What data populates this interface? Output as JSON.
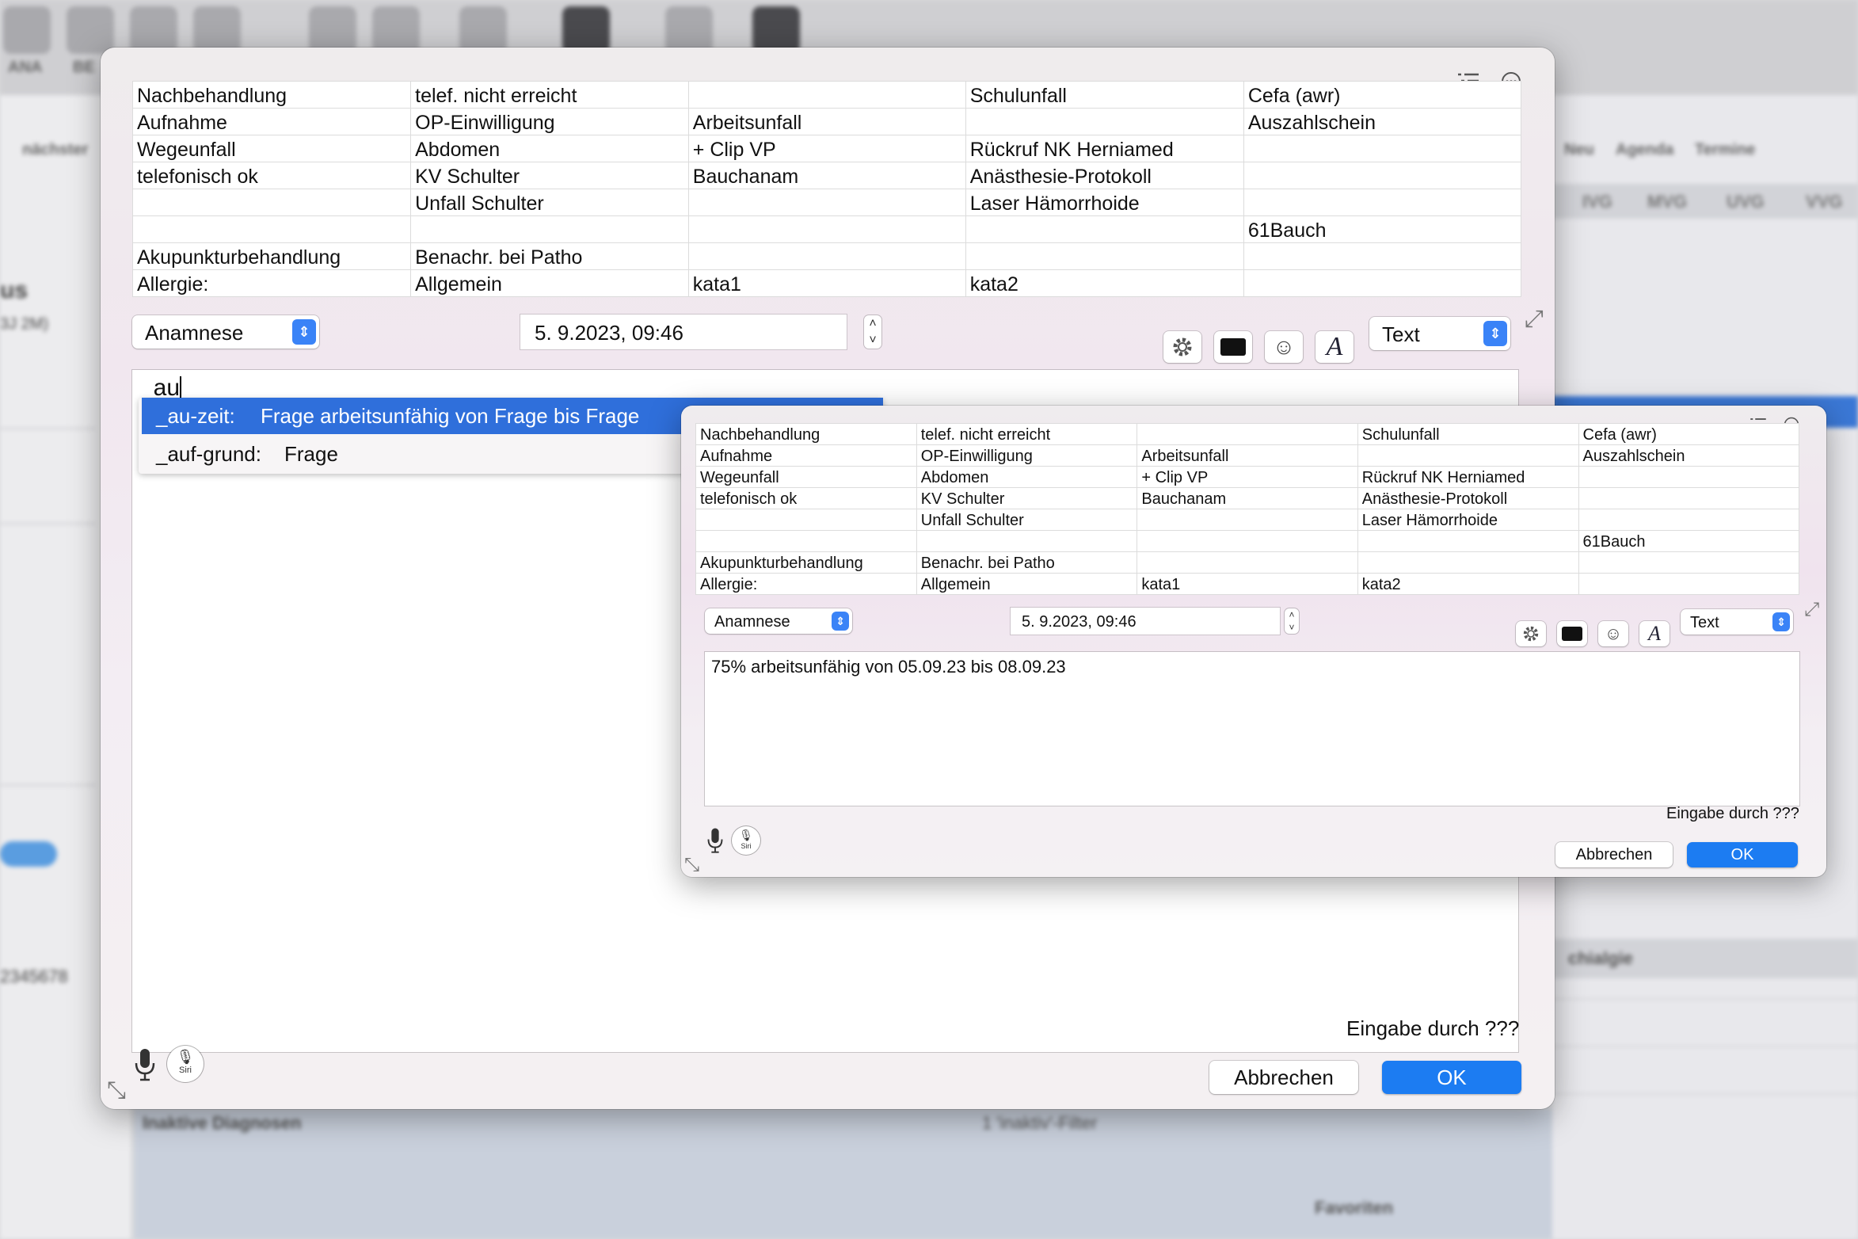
{
  "background": {
    "toolbar_labels": [
      "ANA",
      "BE",
      "nächster",
      "Neu",
      "Agenda",
      "Termine"
    ],
    "right_tabs": [
      "IVG",
      "MVG",
      "UVG",
      "VVG"
    ],
    "bottom_label": "Inaktive Diagnosen",
    "bottom_filter": "1 'inaktiv'-Filter",
    "favorites_label": "Favoriten",
    "sidebar_name": "us",
    "sidebar_age": "3J 2M)",
    "sidebar_number": "2345678",
    "right_section": "chialgie"
  },
  "main_dialog": {
    "grid": [
      [
        "Nachbehandlung",
        "telef. nicht erreicht",
        "",
        "Schulunfall",
        "Cefa (awr)"
      ],
      [
        "Aufnahme",
        "OP-Einwilligung",
        "Arbeitsunfall",
        "",
        "Auszahlschein"
      ],
      [
        "Wegeunfall",
        "Abdomen",
        "+ Clip VP",
        "Rückruf NK Herniamed",
        ""
      ],
      [
        "telefonisch ok",
        "KV Schulter",
        "Bauchanam",
        "Anästhesie-Protokoll",
        ""
      ],
      [
        "",
        "Unfall Schulter",
        "",
        "Laser Hämorrhoide",
        ""
      ],
      [
        "",
        "",
        "",
        "",
        "61Bauch"
      ],
      [
        "Akupunkturbehandlung",
        "Benachr. bei Patho",
        "",
        "",
        ""
      ],
      [
        "Allergie:",
        "Allgemein",
        "kata1",
        "kata2",
        ""
      ]
    ],
    "category_select": "Anamnese",
    "datetime": "5.  9.2023, 09:46",
    "format_select": "Text",
    "input_text": "_au",
    "autocomplete": [
      {
        "key": "_au-zeit:",
        "value": "Frage arbeitsunfähig von Frage bis  Frage"
      },
      {
        "key": "_auf-grund:",
        "value": "Frage"
      }
    ],
    "entry_by": "Eingabe durch ???",
    "cancel_label": "Abbrechen",
    "ok_label": "OK",
    "siri_label": "Siri"
  },
  "small_dialog": {
    "grid": [
      [
        "Nachbehandlung",
        "telef. nicht erreicht",
        "",
        "Schulunfall",
        "Cefa (awr)"
      ],
      [
        "Aufnahme",
        "OP-Einwilligung",
        "Arbeitsunfall",
        "",
        "Auszahlschein"
      ],
      [
        "Wegeunfall",
        "Abdomen",
        "+ Clip VP",
        "Rückruf NK Herniamed",
        ""
      ],
      [
        "telefonisch ok",
        "KV Schulter",
        "Bauchanam",
        "Anästhesie-Protokoll",
        ""
      ],
      [
        "",
        "Unfall Schulter",
        "",
        "Laser Hämorrhoide",
        ""
      ],
      [
        "",
        "",
        "",
        "",
        "61Bauch"
      ],
      [
        "Akupunkturbehandlung",
        "Benachr. bei Patho",
        "",
        "",
        ""
      ],
      [
        "Allergie:",
        "Allgemein",
        "kata1",
        "kata2",
        ""
      ]
    ],
    "category_select": "Anamnese",
    "datetime": "5.  9.2023, 09:46",
    "format_select": "Text",
    "text_content": "75% arbeitsunfähig von 05.09.23 bis 08.09.23",
    "entry_by": "Eingabe durch ???",
    "cancel_label": "Abbrechen",
    "ok_label": "OK",
    "siri_label": "Siri"
  },
  "colors": {
    "accent": "#1c7cf2",
    "selection": "#2f6fdb"
  }
}
